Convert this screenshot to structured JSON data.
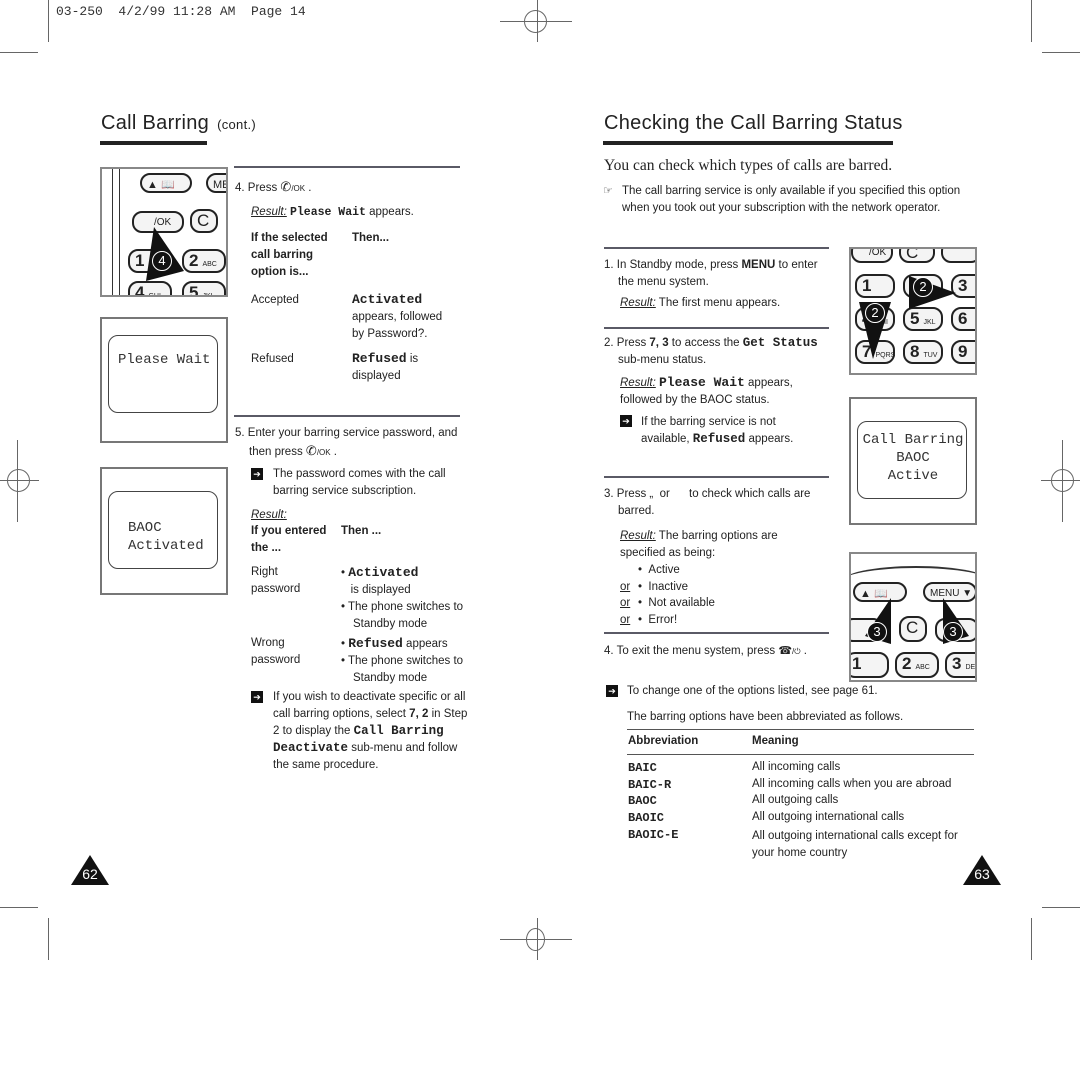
{
  "print_header": "03-250  4/2/99 11:28 AM  Page 14",
  "left_page": {
    "heading": "Call Barring",
    "heading_suffix": "(cont.)",
    "page_number": "62",
    "phone_illustration_top": {
      "keys": [
        "▲ 📖",
        "ME",
        "/OK",
        "C",
        "1",
        "2",
        "ABC",
        "4",
        "GHI",
        "5",
        "JKL"
      ],
      "step_marker": "4"
    },
    "screen_please_wait": {
      "text": "Please Wait"
    },
    "screen_baoc_activated": {
      "line1": "BAOC",
      "line2": "Activated"
    },
    "step4": {
      "number": "4.",
      "text": "Press",
      "key_label": "/OK",
      "result_label": "Result:",
      "result_mono": "Please Wait",
      "result_text": "appears.",
      "table_header": {
        "col1": "If the selected call barring option is...",
        "col2": "Then..."
      },
      "rows": [
        {
          "condition": "Accepted",
          "mono": "Activated",
          "text": "appears, followed by Password?."
        },
        {
          "condition": "Refused",
          "mono": "Refused",
          "text": "is displayed"
        }
      ]
    },
    "step5": {
      "number": "5.",
      "text": "Enter your barring service password, and then press",
      "key_label": "/OK",
      "note": "The password comes with the call barring service subscription.",
      "result_label": "Result:",
      "table_header": {
        "col1": "If you entered the ...",
        "col2": "Then ..."
      },
      "rows": [
        {
          "condition": "Right password",
          "bullets": [
            {
              "mono": "Activated",
              "text": "is displayed"
            },
            {
              "mono": "",
              "text": "The phone switches to Standby mode"
            }
          ]
        },
        {
          "condition": "Wrong password",
          "bullets": [
            {
              "mono": "Refused",
              "text": "appears"
            },
            {
              "mono": "",
              "text": "The phone switches to Standby mode"
            }
          ]
        }
      ],
      "note2_pre": "If you wish to deactivate specific or all call barring options, select",
      "note2_keys": "7, 2",
      "note2_mid": "in Step 2 to display the",
      "note2_mono": "Call Barring Deactivate",
      "note2_post": "sub-menu and follow the same procedure."
    }
  },
  "right_page": {
    "heading": "Checking the Call Barring Status",
    "page_number": "63",
    "subtitle": "You can check which types of calls are barred.",
    "intro_note": "The call barring service is only available if you specified this option when you took out your subscription with the network operator.",
    "step1": {
      "number": "1.",
      "text_pre": "In Standby mode, press",
      "key": "MENU",
      "text_post": "to enter the menu system.",
      "result_label": "Result:",
      "result_text": "The first menu appears."
    },
    "step2": {
      "number": "2.",
      "text_pre": "Press",
      "keys": "7, 3",
      "text_mid": "to access the",
      "mono": "Get Status",
      "text_post": "sub-menu status.",
      "result_label": "Result:",
      "result_mono": "Please Wait",
      "result_text": "appears, followed by the BAOC status.",
      "note_pre": "If the barring service is not available,",
      "note_mono": "Refused",
      "note_post": "appears."
    },
    "step3": {
      "number": "3.",
      "text": "Press „  or      to check which calls are barred.",
      "result_label": "Result:",
      "result_text": "The barring options are specified as being:",
      "options": [
        {
          "prefix": "",
          "label": "Active"
        },
        {
          "prefix": "or",
          "label": "Inactive"
        },
        {
          "prefix": "or",
          "label": "Not available"
        },
        {
          "prefix": "or",
          "label": "Error!"
        }
      ]
    },
    "step4": {
      "number": "4.",
      "text": "To exit the menu system, press",
      "key_label": "/⏻"
    },
    "note_change": "To change one of the options listed, see page 61.",
    "abbrev_intro": "The barring options have been abbreviated as follows.",
    "table": {
      "headers": [
        "Abbreviation",
        "Meaning"
      ],
      "rows": [
        {
          "abbr": "BAIC",
          "meaning": "All incoming calls"
        },
        {
          "abbr": "BAIC-R",
          "meaning": "All incoming calls when you are abroad"
        },
        {
          "abbr": "BAOC",
          "meaning": "All outgoing calls"
        },
        {
          "abbr": "BAOIC",
          "meaning": "All outgoing international calls"
        },
        {
          "abbr": "BAOIC-E",
          "meaning": "All outgoing international calls except for your home country"
        }
      ]
    },
    "phone_keypad": {
      "keys": [
        "/OK",
        "C",
        "1",
        "2",
        "3",
        "4",
        "GHI",
        "5",
        "JKL",
        "6",
        "7",
        "PQRS",
        "8",
        "TUV",
        "9"
      ],
      "step_marker": "2"
    },
    "screen_status": {
      "line1": "Call Barring",
      "line2": "BAOC",
      "line3": "Active"
    },
    "phone_nav": {
      "keys": [
        "▲ 📖",
        "MENU ▼",
        "C",
        "1",
        "2",
        "ABC",
        "3",
        "DEF"
      ],
      "step_marker": "3"
    }
  }
}
